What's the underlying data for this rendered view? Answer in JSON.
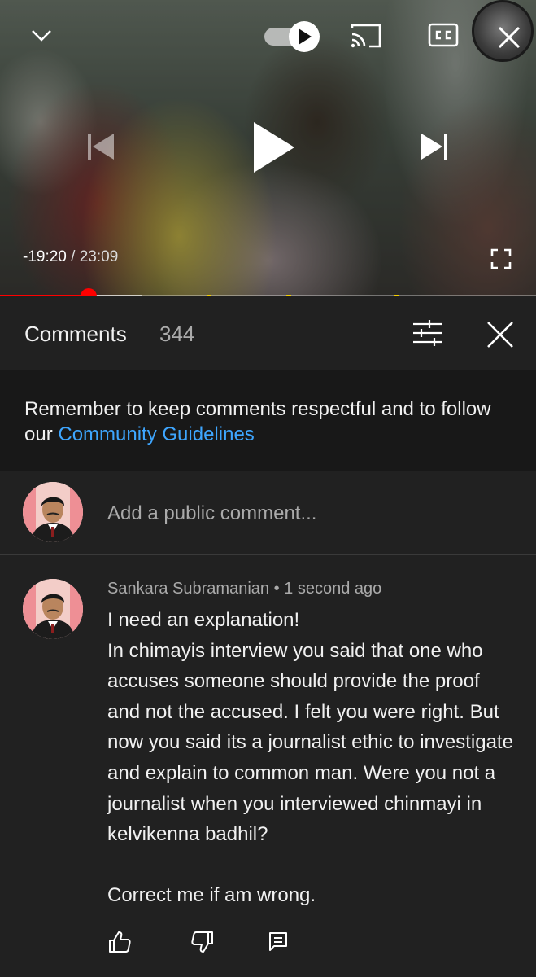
{
  "player": {
    "time_remaining": "-19:20",
    "time_separator": " / ",
    "duration": "23:09",
    "progress_played": 0.165,
    "progress_buffered": 0.265,
    "autoplay_on": true
  },
  "comments_header": {
    "title": "Comments",
    "count": "344"
  },
  "guidelines": {
    "text": "Remember to keep comments respectful and to follow our ",
    "link": "Community Guidelines"
  },
  "add_comment": {
    "placeholder": "Add a public comment..."
  },
  "comment": {
    "author": "Sankara Subramanian",
    "separator": " • ",
    "time": "1 second ago",
    "text": "I need an explanation!\nIn chimayis interview you said that one  who accuses someone should provide the proof and not the accused. I felt you were right. But now you said its a journalist ethic to investigate and explain to common man. Were you not a journalist when you interviewed chinmayi in kelvikenna badhil?\n\nCorrect me if am wrong."
  },
  "colors": {
    "background": "#212121",
    "guidelines_bg": "#181818",
    "link": "#3ea6ff",
    "progress": "#ff0000",
    "muted_text": "#aaaaaa"
  }
}
